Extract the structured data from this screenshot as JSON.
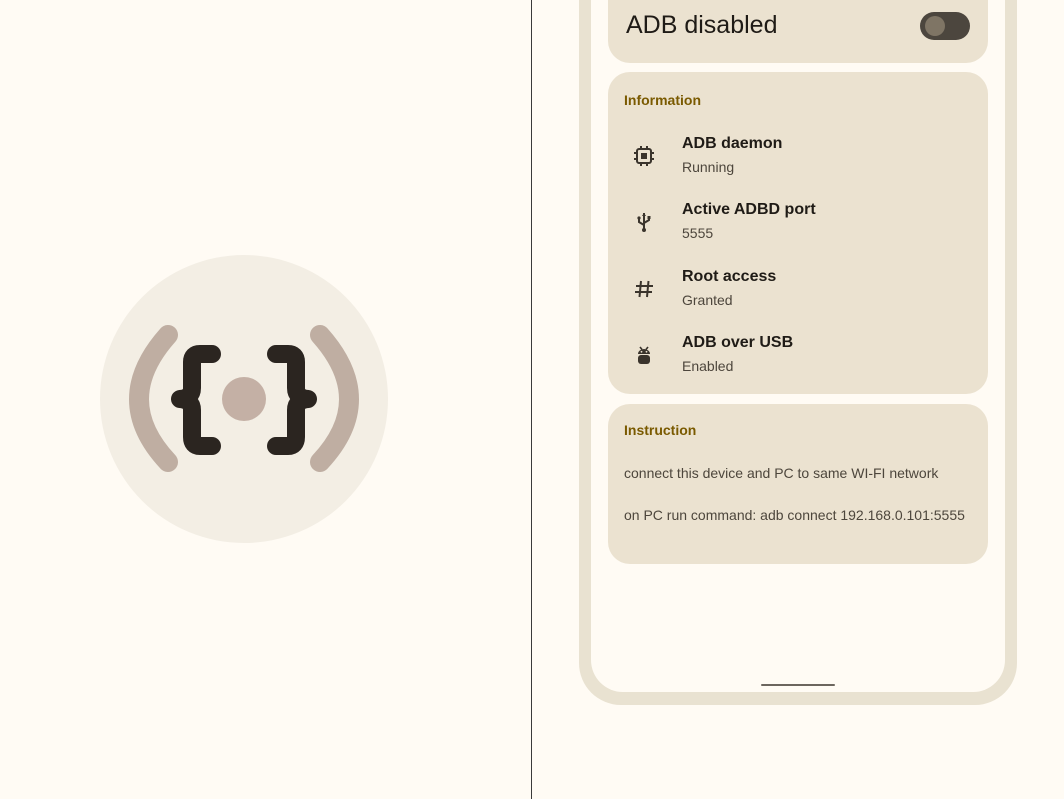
{
  "logo": {
    "icon": "adb-brackets-signal-icon",
    "colors": {
      "circle": "#f3eee4",
      "waves": "#bfaea2",
      "braces": "#2b2520",
      "dot": "#c4b0a5"
    }
  },
  "toggle": {
    "title": "ADB disabled",
    "enabled": false
  },
  "info": {
    "heading": "Information",
    "items": [
      {
        "icon": "chip-icon",
        "title": "ADB daemon",
        "value": "Running"
      },
      {
        "icon": "usb-icon",
        "title": "Active ADBD port",
        "value": "5555"
      },
      {
        "icon": "hash-icon",
        "title": "Root access",
        "value": "Granted"
      },
      {
        "icon": "android-icon",
        "title": "ADB over USB",
        "value": "Enabled"
      }
    ]
  },
  "instruction": {
    "heading": "Instruction",
    "lines": [
      "connect this device and PC to same WI-FI network",
      "on PC run command: adb connect 192.168.0.101:5555"
    ]
  },
  "colors": {
    "accent": "#7a5a00",
    "card": "#ebe2d0",
    "background": "#fffbf4",
    "frame": "#e9e2d1"
  }
}
